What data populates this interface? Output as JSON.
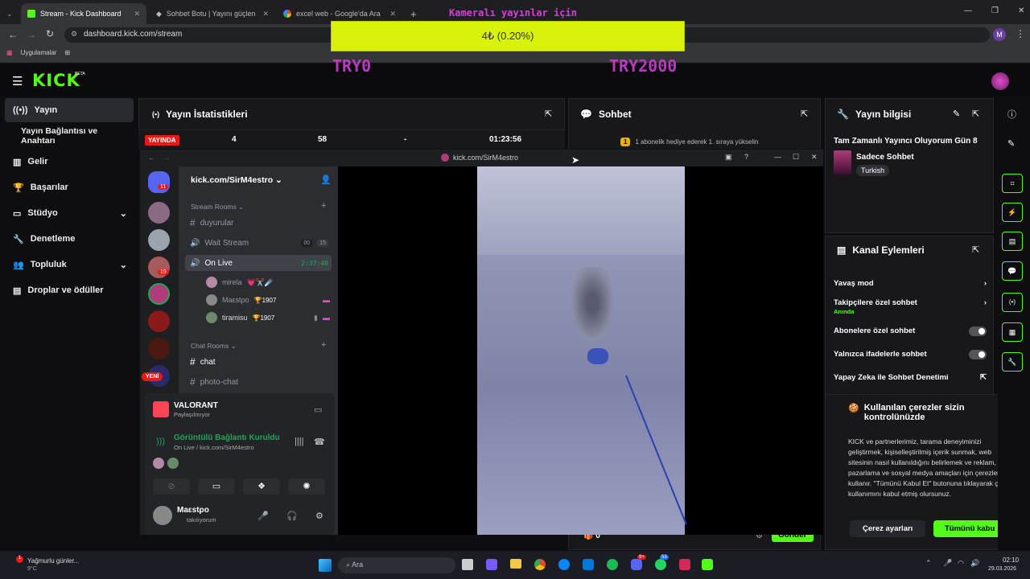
{
  "browser": {
    "tabs": [
      {
        "label": "Stream - Kick Dashboard",
        "active": true
      },
      {
        "label": "Sohbet Botu | Yayını güçlendi",
        "active": false
      },
      {
        "label": "excel web - Google'da Ara",
        "active": false
      }
    ],
    "url": "dashboard.kick.com/stream",
    "bookmarks": [
      "Uygulamalar"
    ],
    "profile_initial": "M"
  },
  "overlay": {
    "title": "Kameralı yayınlar için",
    "goal_value": "4₺ (0.20%)",
    "goal_fraction": 0.002,
    "min_label": "TRY0",
    "max_label": "TRY2000"
  },
  "kick": {
    "logo": "KICK",
    "logo_badge": "BETA"
  },
  "sidebar": {
    "items": [
      {
        "label": "Yayın",
        "icon": "broadcast-icon",
        "active": true
      },
      {
        "label": "Yayın Bağlantısı ve Anahtarı",
        "icon": "",
        "active": false
      },
      {
        "label": "Gelir",
        "icon": "revenue-icon",
        "active": false
      },
      {
        "label": "Başarılar",
        "icon": "trophy-icon",
        "active": false
      },
      {
        "label": "Stüdyo",
        "icon": "studio-icon",
        "active": false
      },
      {
        "label": "Denetleme",
        "icon": "wrench-icon",
        "active": false
      },
      {
        "label": "Topluluk",
        "icon": "community-icon",
        "active": false
      },
      {
        "label": "Droplar ve ödüller",
        "icon": "drops-icon",
        "active": false
      }
    ]
  },
  "stats": {
    "title": "Yayın İstatistikleri",
    "live_badge": "YAYINDA",
    "values": [
      "4",
      "58",
      "-",
      "01:23:56"
    ]
  },
  "chat": {
    "title": "Sohbet",
    "notice_count": "1",
    "notice": "1 abonelik hediye ederek 1. sıraya yükselin",
    "send_label": "Gönder",
    "points": "0"
  },
  "stream_info": {
    "title": "Yayın bilgisi",
    "stream_title": "Tam Zamanlı Yayıncı Oluyorum Gün 8",
    "category": "Sadece Sohbet",
    "language": "Turkish"
  },
  "channel_actions": {
    "title": "Kanal Eylemleri",
    "slow_mode": "Yavaş mod",
    "followers_only": "Takipçilere özel sohbet",
    "followers_only_sub": "Anında",
    "subscribers_only": "Abonelere özel sohbet",
    "emotes_only": "Yalnızca ifadelerle sohbet",
    "ai_moderation": "Yapay Zeka ile Sohbet Denetimi"
  },
  "cookie": {
    "title": "Kullanılan çerezler sizin kontrolünüzde",
    "body": "KICK ve partnerlerimiz, tarama deneyiminizi geliştirmek, kişiselleştirilmiş içerik sunmak, web sitesinin nasıl kullanıldığını belirlemek ve reklam, pazarlama ve sosyal medya amaçları için çerezleri kullanır. \"Tümünü Kabul Et\" butonuna tıklayarak çerez kullanımını kabul etmiş olursunuz.",
    "settings_button": "Çerez ayarları",
    "accept_button": "Tümünü kabul"
  },
  "discord": {
    "window_title": "kick.com/SirM4estro",
    "server_name": "kick.com/SirM4estro",
    "notif_count": "11",
    "server_badge": "19",
    "new_badge": "YENİ",
    "category_stream": "Stream Rooms",
    "category_chat": "Chat Rooms",
    "channels": {
      "duyurular": "duyurular",
      "wait_stream": "Wait Stream",
      "wait_count_a": "00",
      "wait_count_b": "15",
      "on_live": "On Live",
      "on_live_time": "2:37:40",
      "chat": "chat",
      "photo_chat": "photo-chat"
    },
    "voice_users": [
      {
        "name": "mirela",
        "extra": "💗✂️☄️"
      },
      {
        "name": "Μaεstρo",
        "extra": "🏆1907"
      },
      {
        "name": "tiramisu",
        "extra": "🏆1907"
      }
    ],
    "activity": {
      "game": "VALORANT",
      "status": "Paylaşılmıyor"
    },
    "connection": {
      "title": "Görüntülü Bağlantı Kuruldu",
      "sub": "On Live / kick.com/SirM4estro"
    },
    "user": {
      "name": "Μaεstρo",
      "status": "takılıyorum"
    }
  },
  "taskbar": {
    "weather": "Yağmurlu günler...",
    "temp": "9°C",
    "search": "Ara",
    "time": "02:10",
    "date": "29.03.2026",
    "badge_a": "9+",
    "badge_b": "53"
  },
  "colors": {
    "kick_green": "#53fc18",
    "goal_yellow": "#d9f20a",
    "overlay_purple": "#b83bbf",
    "live_red": "#e91916",
    "discord_green": "#23a55a"
  }
}
